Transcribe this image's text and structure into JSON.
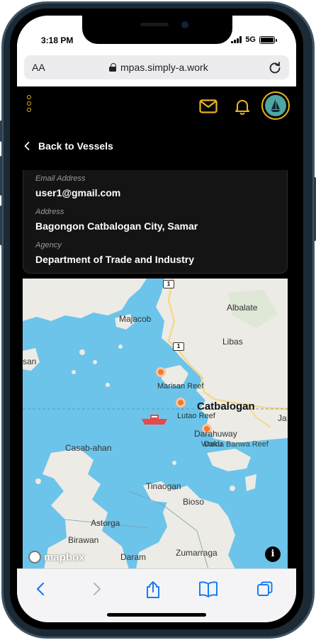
{
  "status_bar": {
    "time": "3:18 PM",
    "network": "5G"
  },
  "browser": {
    "aa_label": "AA",
    "url": "mpas.simply-a.work"
  },
  "app": {
    "back_label": "Back to Vessels",
    "accent_color": "#e8b420",
    "info": {
      "email_label": "Email Address",
      "email_value": "user1@gmail.com",
      "address_label": "Address",
      "address_value": "Bagongon Catbalogan City, Samar",
      "agency_label": "Agency",
      "agency_value": "Department of Trade and Industry"
    }
  },
  "map": {
    "labels": {
      "majacob": "Majacob",
      "albalate": "Albalate",
      "libas": "Libas",
      "san": "san",
      "marisan_reef": "Marisan Reef",
      "catbalogan": "Catbalogan",
      "lutao_reef": "Lutao Reef",
      "darahuway": "Darahuway",
      "daku": "Daku",
      "warda_banwa": "Warda Banwa Reef",
      "casab_ahan": "Casab-ahan",
      "tinaogan": "Tinaogan",
      "bioso": "Bioso",
      "astorga": "Astorga",
      "birawan": "Birawan",
      "daram": "Daram",
      "zumarraga": "Zumarraga",
      "ja": "Ja"
    },
    "road_shield_top": "1",
    "road_shield_mid": "1",
    "attribution": "mapbox",
    "info_glyph": "i",
    "vessel_icon": "boat-icon",
    "colors": {
      "water": "#6cc4ea",
      "land": "#ecebe5",
      "marker": "#f07b2c",
      "road": "#f5d98a"
    }
  },
  "toolbar": {
    "back_icon": "chevron-left-icon",
    "forward_icon": "chevron-right-icon",
    "share_icon": "share-icon",
    "bookmarks_icon": "book-icon",
    "tabs_icon": "tabs-icon"
  }
}
